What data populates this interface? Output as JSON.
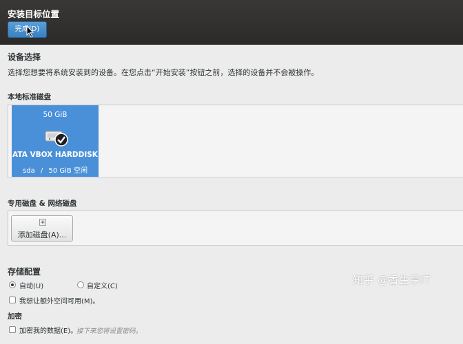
{
  "header": {
    "title": "安装目标位置",
    "done_button": "完成(D)"
  },
  "device_selection": {
    "title": "设备选择",
    "description": "选择您想要将系统安装到的设备。在您点击“开始安装”按钮之前，选择的设备并不会被操作。"
  },
  "local_disks": {
    "title": "本地标准磁盘",
    "disk": {
      "size": "50 GiB",
      "name": "ATA VBOX HARDDISK",
      "device": "sda",
      "separator": "/",
      "free": "50 GiB 空闲",
      "selected": true
    }
  },
  "special_disks": {
    "title": "专用磁盘 & 网络磁盘",
    "add_button": "添加磁盘(A)..."
  },
  "storage_config": {
    "title": "存储配置",
    "auto_label": "自动(U)",
    "custom_label": "自定义(C)",
    "selected": "auto",
    "extra_space_label": "我想让额外空间可用(M)。"
  },
  "encryption": {
    "title": "加密",
    "encrypt_label": "加密我的数据(E)。",
    "hint": "接下来您将设置密码。"
  },
  "watermark": "知乎 @香生享IT",
  "colors": {
    "accent": "#4a90d9",
    "header_bg": "#2b2a29",
    "page_bg": "#ececec"
  }
}
